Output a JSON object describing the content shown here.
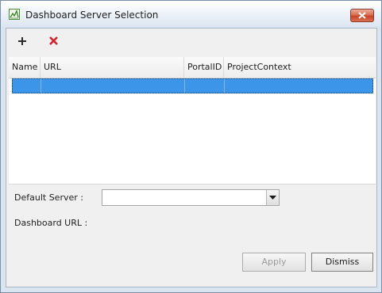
{
  "window": {
    "title": "Dashboard Server Selection"
  },
  "toolbar": {
    "add_icon": "plus-icon",
    "remove_icon": "red-x-icon",
    "remove_color": "#d0202e"
  },
  "table": {
    "columns": [
      "Name",
      "URL",
      "PortalID",
      "ProjectContext"
    ],
    "rows": [
      {
        "name": "",
        "url": "",
        "portal_id": "",
        "project_context": "",
        "selected": true
      }
    ],
    "selection_color": "#3d95ea"
  },
  "form": {
    "default_server_label": "Default Server :",
    "default_server_value": "",
    "dashboard_url_label": "Dashboard URL :",
    "dashboard_url_value": ""
  },
  "buttons": {
    "apply": "Apply",
    "apply_enabled": false,
    "dismiss": "Dismiss"
  }
}
